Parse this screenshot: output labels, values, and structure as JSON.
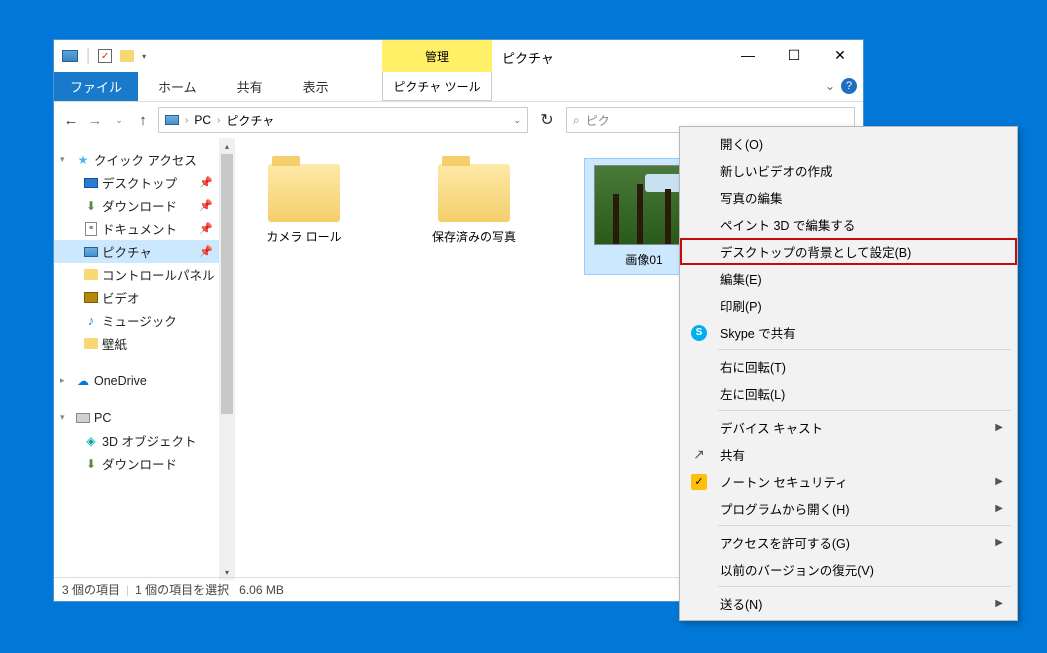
{
  "window": {
    "manage_tab": "管理",
    "title": "ピクチャ",
    "file_tab": "ファイル",
    "tabs": [
      "ホーム",
      "共有",
      "表示"
    ],
    "pic_tool_tab": "ピクチャ ツール",
    "min": "—",
    "max": "☐",
    "close": "✕",
    "ribbon_caret": "⌄"
  },
  "addr": {
    "back": "←",
    "fwd": "→",
    "up": "↑",
    "dropdown": "⌄",
    "refresh": "↻",
    "crumbs": [
      "PC",
      "ピクチャ"
    ],
    "search_icon": "⌕",
    "search_placeholder": "ピク"
  },
  "nav": {
    "quick_access": "クイック アクセス",
    "desktop": "デスクトップ",
    "downloads": "ダウンロード",
    "documents": "ドキュメント",
    "pictures": "ピクチャ",
    "control_panel": "コントロールパネル",
    "videos": "ビデオ",
    "music": "ミュージック",
    "wallpaper": "壁紙",
    "onedrive": "OneDrive",
    "pc": "PC",
    "obj3d": "3D オブジェクト",
    "downloads2": "ダウンロード",
    "pin_char": "📌"
  },
  "items": {
    "camera_roll": "カメラ ロール",
    "saved_photos": "保存済みの写真",
    "image01": "画像01"
  },
  "status": {
    "count": "3 個の項目",
    "selection": "1 個の項目を選択",
    "size": "6.06 MB"
  },
  "ctx": {
    "open": "開く(O)",
    "new_video": "新しいビデオの作成",
    "edit_photo": "写真の編集",
    "paint3d": "ペイント 3D で編集する",
    "set_bg": "デスクトップの背景として設定(B)",
    "edit": "編集(E)",
    "print": "印刷(P)",
    "skype": "Skype で共有",
    "rot_r": "右に回転(T)",
    "rot_l": "左に回転(L)",
    "cast": "デバイス キャスト",
    "share": "共有",
    "norton": "ノートン セキュリティ",
    "open_with": "プログラムから開く(H)",
    "access": "アクセスを許可する(G)",
    "prev_ver": "以前のバージョンの復元(V)",
    "send": "送る(N)"
  }
}
